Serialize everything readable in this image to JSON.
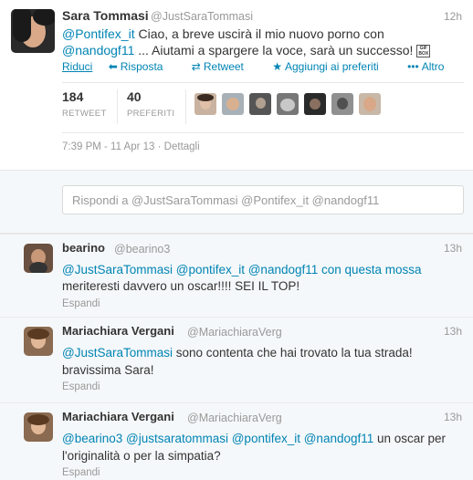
{
  "main_tweet": {
    "fullname": "Sara Tommasi",
    "username": "@JustSaraTommasi",
    "time": "12h",
    "line1_mention": "@Pontifex_it",
    "line1_text": " Ciao, a breve uscirà il mio nuovo porno con",
    "line2_mention": "@nandogf11",
    "line2_text": " ... Aiutami a spargere la voce, sarà un successo! ",
    "emoji_box": "GIF\nBOX",
    "actions": {
      "collapse": "Riduci",
      "reply": "Risposta",
      "retweet": "Retweet",
      "favorite": "Aggiungi ai preferiti",
      "more": "Altro"
    },
    "stats": {
      "retweets_count": "184",
      "retweets_label": "RETWEET",
      "favorites_count": "40",
      "favorites_label": "PREFERITI"
    },
    "meta": {
      "datetime": "7:39 PM - 11 Apr 13",
      "details": "Dettagli"
    }
  },
  "reply_box": {
    "text": "Rispondi a @JustSaraTommasi @Pontifex_it @nandogf11"
  },
  "replies": [
    {
      "fullname": "bearino",
      "username": "@bearino3",
      "time": "13h",
      "line1": "@JustSaraTommasi @pontifex_it @nandogf11 con questa mossa",
      "line2": "meriteresti davvero un oscar!!!! SEI IL TOP!",
      "expand": "Espandi"
    },
    {
      "fullname": "Mariachiara Vergani",
      "username": "@MariachiaraVerg",
      "time": "13h",
      "line1_mention": "@JustSaraTommasi",
      "line1_text": " sono contenta che hai trovato la tua strada!",
      "line2": "bravissima Sara!",
      "expand": "Espandi"
    },
    {
      "fullname": "Mariachiara Vergani",
      "username": "@MariachiaraVerg",
      "time": "13h",
      "line1_mentions": "@bearino3 @justsaratommasi @pontifex_it @nandogf11",
      "line1_text": " un oscar per",
      "line2": "l'originalità o per la simpatia?",
      "expand": "Espandi"
    }
  ],
  "icons": {
    "reply": "reply-arrow-icon",
    "retweet": "retweet-icon",
    "favorite": "star-icon",
    "more": "ellipsis-icon"
  },
  "colors": {
    "link": "#0084b4",
    "muted": "#999999",
    "text": "#333333",
    "reply_background": "#f5f8fa"
  }
}
